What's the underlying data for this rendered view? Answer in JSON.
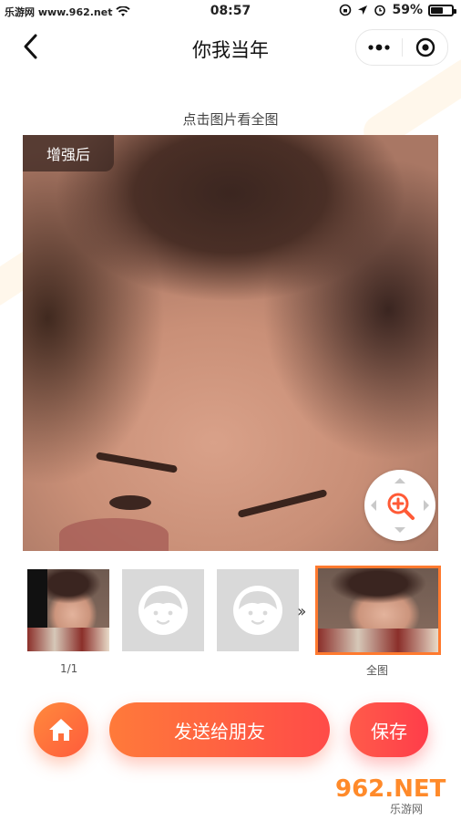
{
  "status_bar": {
    "carrier": "乐游网 www.962.net",
    "time": "08:57",
    "battery_percent": "59%",
    "battery_level": 0.59
  },
  "nav": {
    "title": "你我当年"
  },
  "hint": "点击图片看全图",
  "photo": {
    "badge": "增强后"
  },
  "thumbnails": {
    "first_label": "1/1",
    "full_label": "全图"
  },
  "actions": {
    "send_label": "发送给朋友",
    "save_label": "保存"
  },
  "watermark": {
    "logo_text": "962.NET",
    "sub_text": "乐游网"
  },
  "colors": {
    "accent": "#ff6a3d",
    "selected_border": "#ff7a2f"
  }
}
